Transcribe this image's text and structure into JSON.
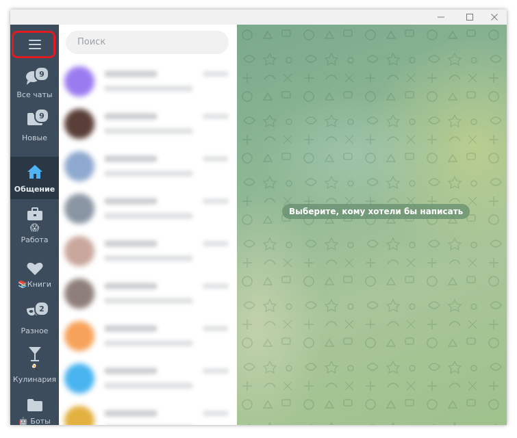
{
  "window": {
    "controls": [
      "minimize-icon",
      "maximize-icon",
      "close-icon"
    ]
  },
  "sidebar": {
    "menu_icon": "hamburger-menu-icon",
    "folders": [
      {
        "label": "Все чаты",
        "icon": "chats-icon",
        "badge": "9",
        "active": false
      },
      {
        "label": "Новые",
        "icon": "folder-icon",
        "badge": "9",
        "active": false
      },
      {
        "label": "Общение",
        "icon": "house-icon",
        "badge": "",
        "active": true
      },
      {
        "label": "Работа",
        "icon": "briefcase-icon",
        "emoji": "😱",
        "badge": "",
        "active": false
      },
      {
        "label": "Книги",
        "icon": "heart-icon",
        "emoji": "📚",
        "badge": "",
        "active": false
      },
      {
        "label": "Разное",
        "icon": "mask-icon",
        "badge": "2",
        "active": false
      },
      {
        "label": "Кулинария",
        "icon": "cocktail-icon",
        "emoji": "🍳",
        "badge": "",
        "active": false
      },
      {
        "label": "Боты",
        "icon": "folder-icon",
        "emoji": "🤖",
        "badge": "",
        "active": false
      }
    ]
  },
  "search": {
    "placeholder": "Поиск"
  },
  "chats": [
    {
      "avatar_color": "#9b7bf0"
    },
    {
      "avatar_color": "#5a3f38"
    },
    {
      "avatar_color": "#8ea9cf"
    },
    {
      "avatar_color": "#8a95a3"
    },
    {
      "avatar_color": "#c9a79c"
    },
    {
      "avatar_color": "#8f7f7a"
    },
    {
      "avatar_color": "#f7a25a"
    },
    {
      "avatar_color": "#49b4f0"
    },
    {
      "avatar_color": "#e3b13f"
    }
  ],
  "chat_area": {
    "empty_message": "Выберите, кому хотели бы написать"
  },
  "colors": {
    "sidebar": "#3d4c5c",
    "sidebar_active": "#2a3744",
    "highlight": "#e11b22",
    "accent_active": "#4fb3f6"
  }
}
